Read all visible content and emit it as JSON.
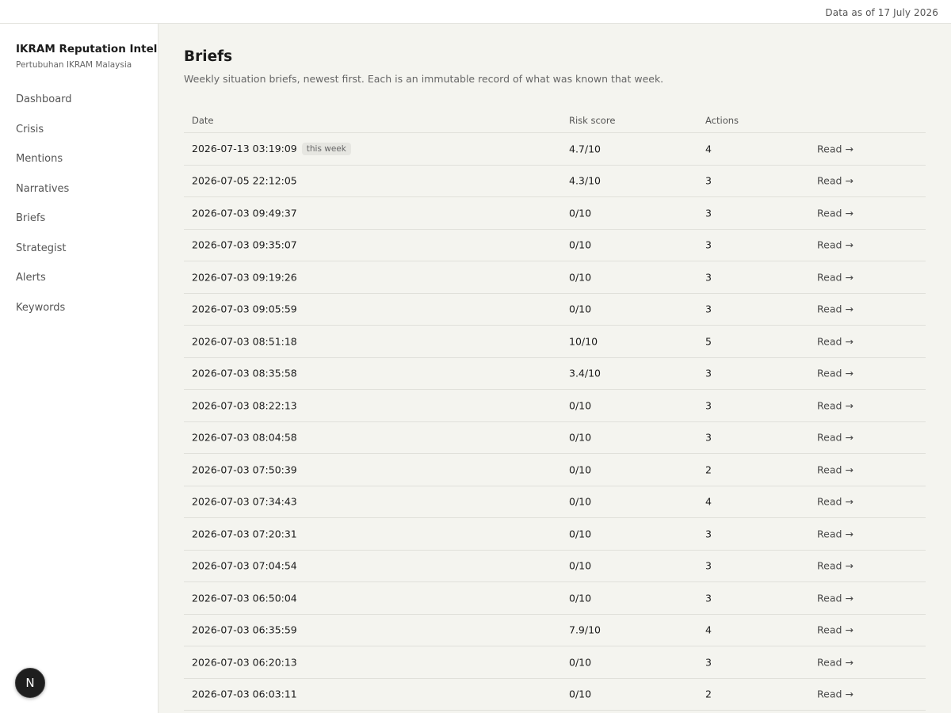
{
  "topbar": {
    "as_of": "Data as of 17 July 2026"
  },
  "sidebar": {
    "title": "IKRAM Reputation Intel",
    "subtitle": "Pertubuhan IKRAM Malaysia",
    "items": [
      {
        "label": "Dashboard"
      },
      {
        "label": "Crisis"
      },
      {
        "label": "Mentions"
      },
      {
        "label": "Narratives"
      },
      {
        "label": "Briefs"
      },
      {
        "label": "Strategist"
      },
      {
        "label": "Alerts"
      },
      {
        "label": "Keywords"
      }
    ]
  },
  "badge": {
    "letter": "N"
  },
  "page": {
    "title": "Briefs",
    "description": "Weekly situation briefs, newest first. Each is an immutable record of what was known that week."
  },
  "table": {
    "headers": {
      "date": "Date",
      "risk": "Risk score",
      "actions": "Actions"
    },
    "this_week_label": "this week",
    "read_label": "Read →",
    "rows": [
      {
        "date": "2026-07-13 03:19:09",
        "risk": "4.7/10",
        "actions": "4"
      },
      {
        "date": "2026-07-05 22:12:05",
        "risk": "4.3/10",
        "actions": "3"
      },
      {
        "date": "2026-07-03 09:49:37",
        "risk": "0/10",
        "actions": "3"
      },
      {
        "date": "2026-07-03 09:35:07",
        "risk": "0/10",
        "actions": "3"
      },
      {
        "date": "2026-07-03 09:19:26",
        "risk": "0/10",
        "actions": "3"
      },
      {
        "date": "2026-07-03 09:05:59",
        "risk": "0/10",
        "actions": "3"
      },
      {
        "date": "2026-07-03 08:51:18",
        "risk": "10/10",
        "actions": "5"
      },
      {
        "date": "2026-07-03 08:35:58",
        "risk": "3.4/10",
        "actions": "3"
      },
      {
        "date": "2026-07-03 08:22:13",
        "risk": "0/10",
        "actions": "3"
      },
      {
        "date": "2026-07-03 08:04:58",
        "risk": "0/10",
        "actions": "3"
      },
      {
        "date": "2026-07-03 07:50:39",
        "risk": "0/10",
        "actions": "2"
      },
      {
        "date": "2026-07-03 07:34:43",
        "risk": "0/10",
        "actions": "4"
      },
      {
        "date": "2026-07-03 07:20:31",
        "risk": "0/10",
        "actions": "3"
      },
      {
        "date": "2026-07-03 07:04:54",
        "risk": "0/10",
        "actions": "3"
      },
      {
        "date": "2026-07-03 06:50:04",
        "risk": "0/10",
        "actions": "3"
      },
      {
        "date": "2026-07-03 06:35:59",
        "risk": "7.9/10",
        "actions": "4"
      },
      {
        "date": "2026-07-03 06:20:13",
        "risk": "0/10",
        "actions": "3"
      },
      {
        "date": "2026-07-03 06:03:11",
        "risk": "0/10",
        "actions": "2"
      }
    ]
  }
}
